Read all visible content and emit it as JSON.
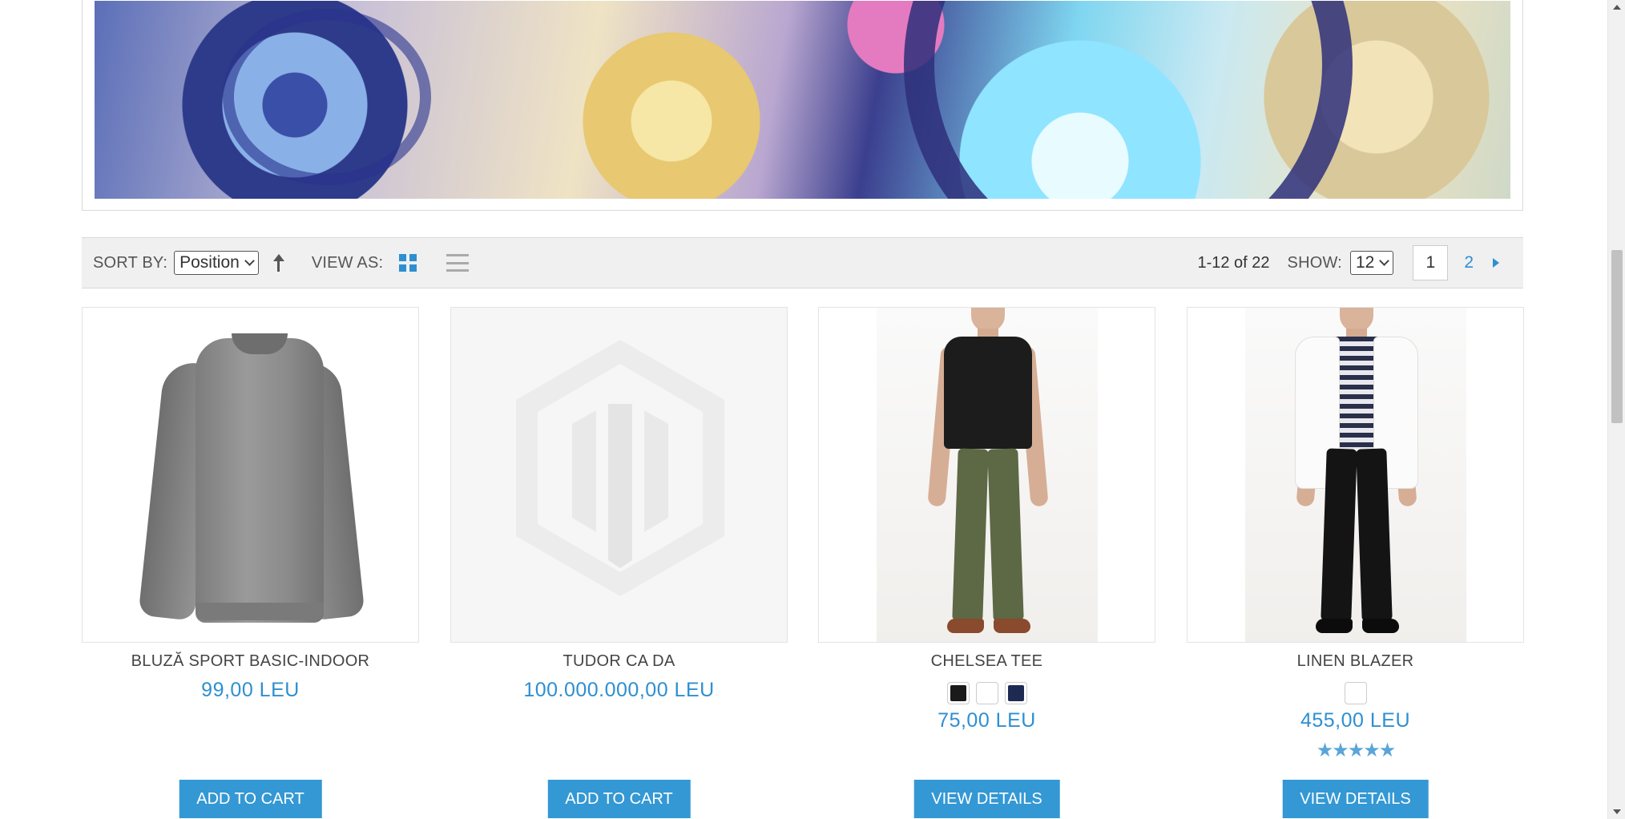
{
  "toolbar": {
    "sort_label": "SORT BY:",
    "sort_value": "Position",
    "view_label": "VIEW AS:",
    "amount": "1-12 of 22",
    "show_label": "SHOW:",
    "show_value": "12",
    "pages": [
      "1",
      "2"
    ],
    "current_page": "1"
  },
  "products": [
    {
      "name": "BLUZĂ SPORT BASIC-INDOOR",
      "price": "99,00 LEU",
      "button": "ADD TO CART"
    },
    {
      "name": "TUDOR CA DA",
      "price": "100.000.000,00 LEU",
      "button": "ADD TO CART"
    },
    {
      "name": "CHELSEA TEE",
      "price": "75,00 LEU",
      "button": "VIEW DETAILS",
      "swatches": [
        "#1a1a1a",
        "#ffffff",
        "#1f2a52"
      ]
    },
    {
      "name": "LINEN BLAZER",
      "price": "455,00 LEU",
      "button": "VIEW DETAILS",
      "swatches": [
        "#ffffff"
      ],
      "rating": "★★★★★",
      "rating_value": 5
    }
  ],
  "colors": {
    "accent": "#3498d4",
    "price": "#2e8fd0"
  }
}
